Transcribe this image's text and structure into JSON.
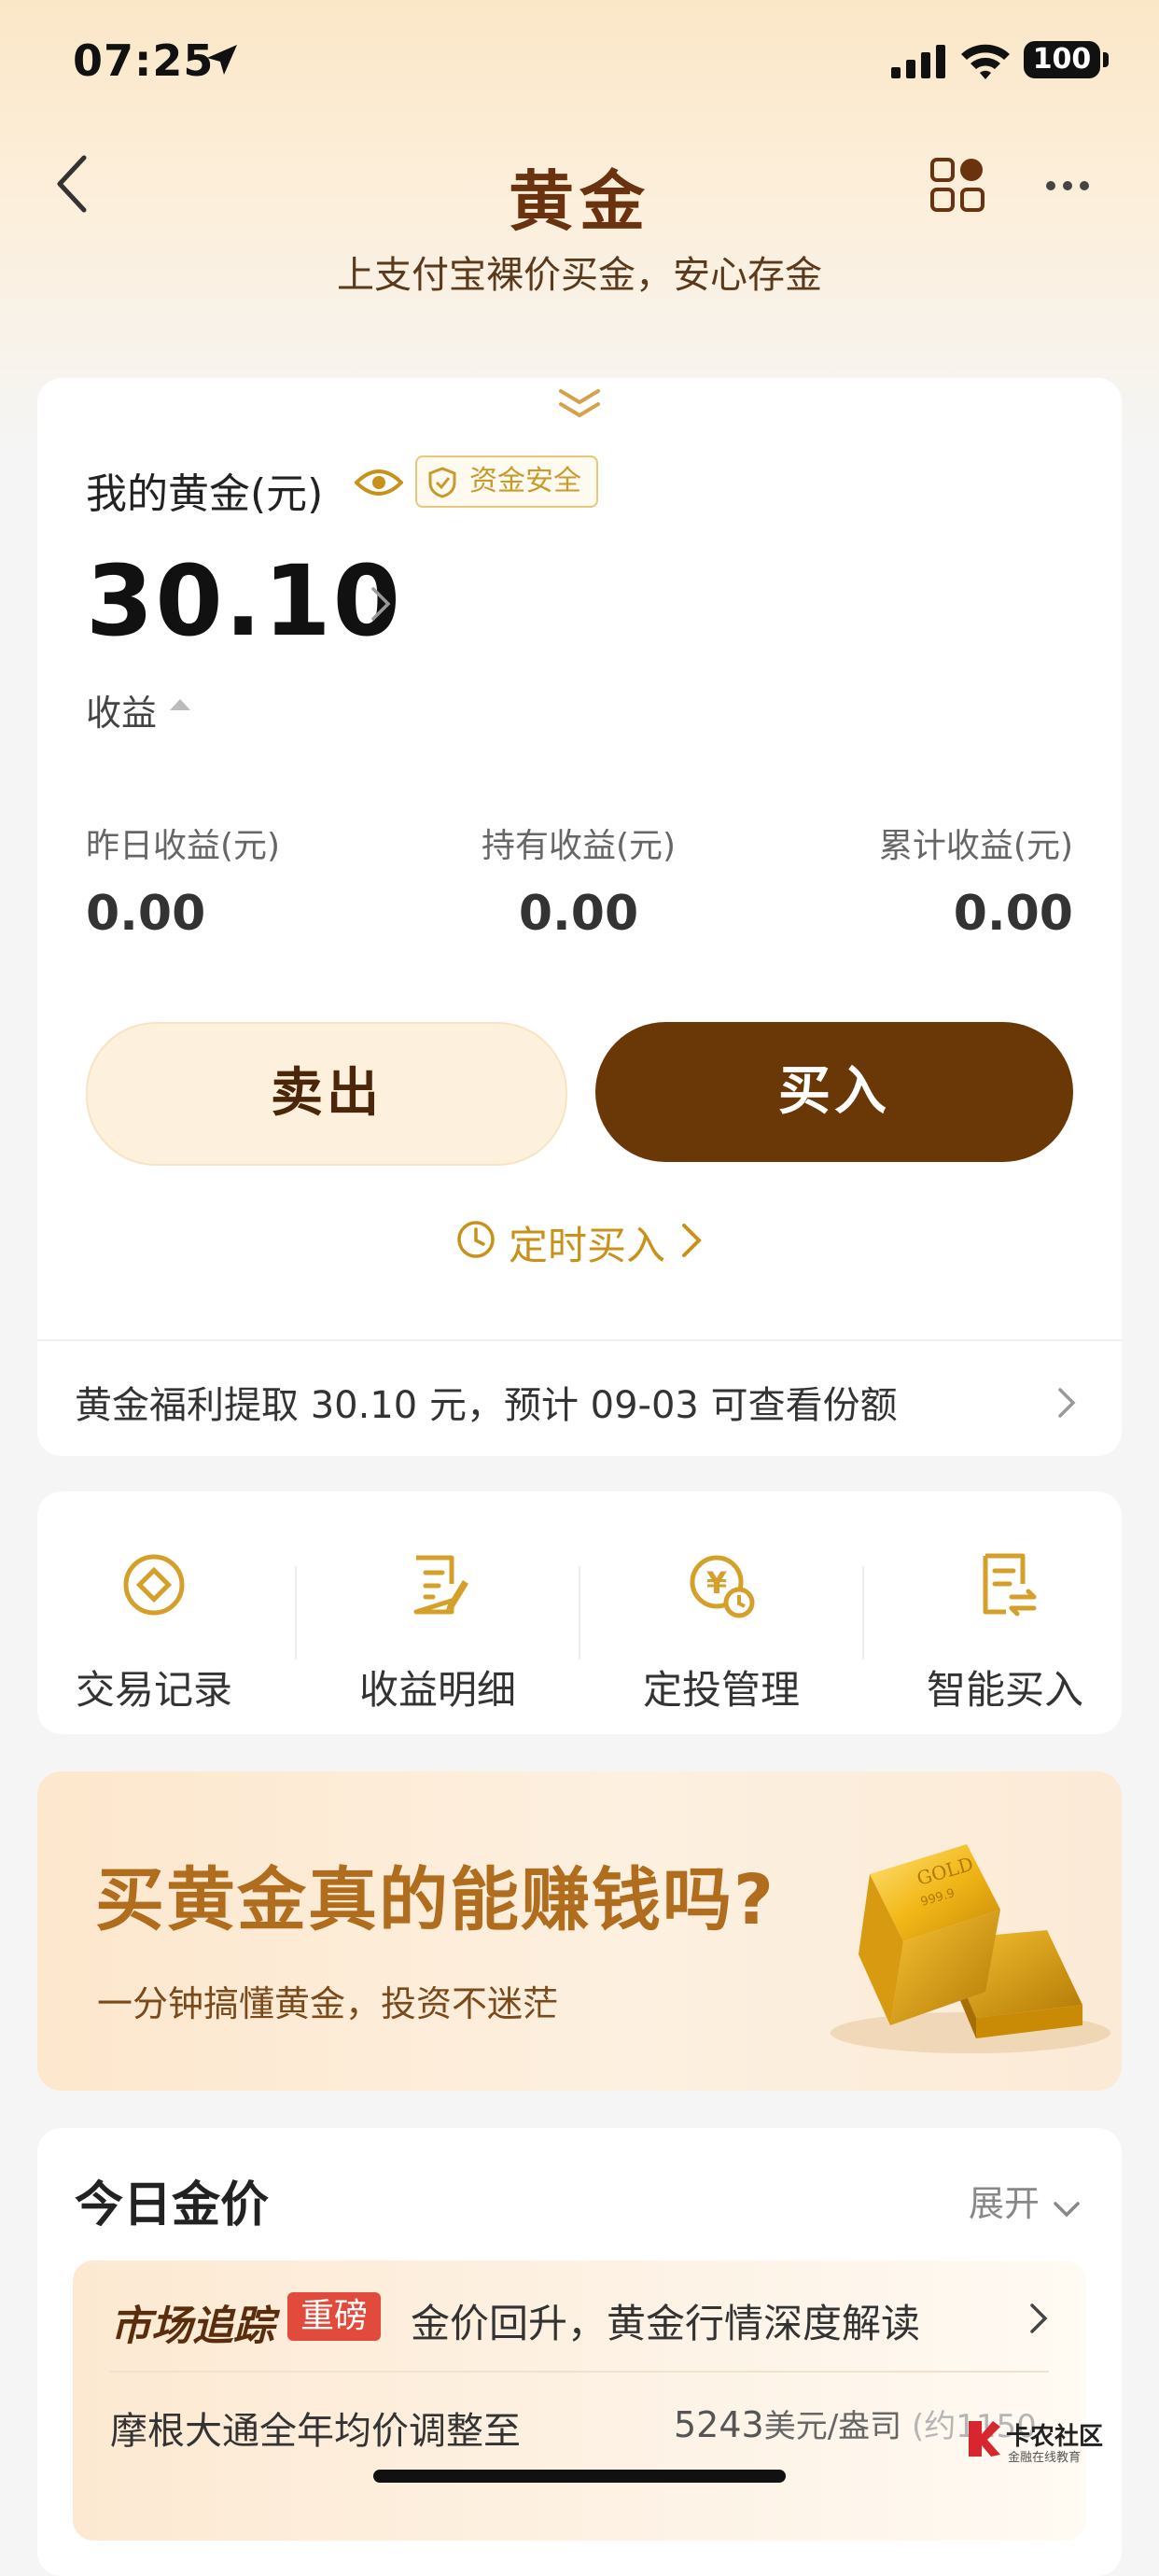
{
  "status_bar": {
    "time": "07:25",
    "battery": "100"
  },
  "header": {
    "title": "黄金",
    "subtitle": "上支付宝裸价买金，安心存金"
  },
  "account": {
    "label": "我的黄金(元)",
    "badge": "资金安全",
    "amount": "30.10",
    "income_label": "收益",
    "stats": [
      {
        "label": "昨日收益(元)",
        "value": "0.00"
      },
      {
        "label": "持有收益(元)",
        "value": "0.00"
      },
      {
        "label": "累计收益(元)",
        "value": "0.00"
      }
    ],
    "sell_label": "卖出",
    "buy_label": "买入",
    "timed_buy_label": "定时买入",
    "welfare_text": "黄金福利提取 30.10 元，预计 09-03 可查看份额"
  },
  "quick_actions": [
    {
      "label": "交易记录",
      "icon": "record-icon"
    },
    {
      "label": "收益明细",
      "icon": "income-detail-icon"
    },
    {
      "label": "定投管理",
      "icon": "investment-plan-icon"
    },
    {
      "label": "智能买入",
      "icon": "smart-buy-icon"
    }
  ],
  "banner": {
    "title": "买黄金真的能赚钱吗?",
    "subtitle": "一分钟搞懂黄金，投资不迷茫",
    "bar_text_1": "GOLD",
    "bar_text_2": "999.9"
  },
  "today_price": {
    "title": "今日金价",
    "expand_label": "展开",
    "news_brand": "市场追踪",
    "news_tag": "重磅",
    "news_text": "金价回升，黄金行情深度解读",
    "news_line2": "摩根大通全年均价调整至",
    "price_value": "5243",
    "price_unit": "美元/盎司",
    "price_extra": "(约1150"
  },
  "watermark": {
    "name": "卡农社区",
    "sub": "金融在线教育"
  },
  "colors": {
    "brand_brown": "#6a3806",
    "gold": "#c8911a",
    "tag_red": "#e24b3b"
  }
}
